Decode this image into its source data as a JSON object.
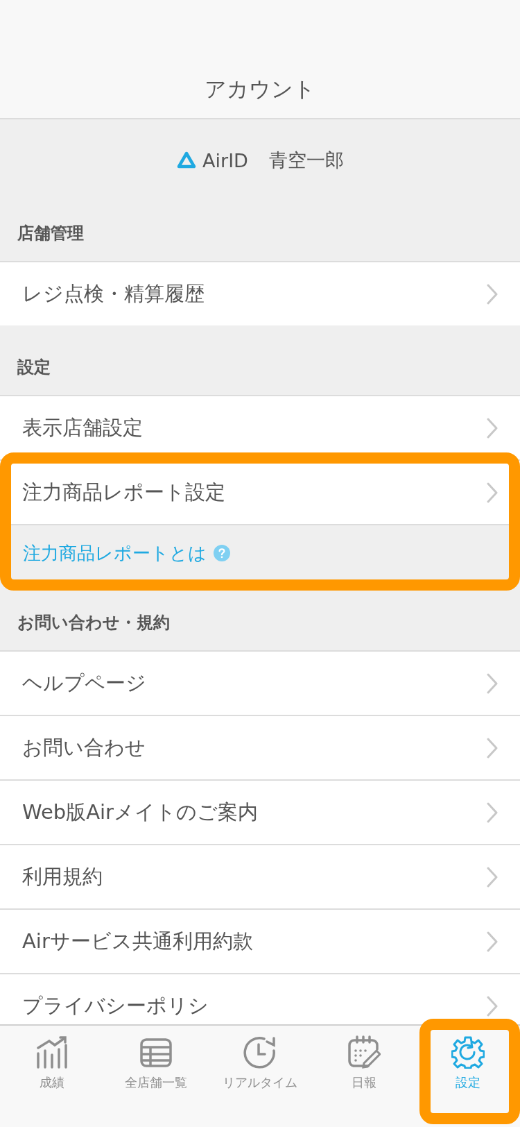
{
  "header": {
    "title": "アカウント"
  },
  "account": {
    "label": "AirID",
    "name": "青空一郎"
  },
  "sections": [
    {
      "title": "店舗管理",
      "items": [
        {
          "label": "レジ点検・精算履歴",
          "highlighted": false
        }
      ]
    },
    {
      "title": "設定",
      "items": [
        {
          "label": "表示店舗設定",
          "highlighted": false
        },
        {
          "label": "注力商品レポート設定",
          "highlighted": true,
          "help_link": "注力商品レポートとは"
        }
      ]
    },
    {
      "title": "お問い合わせ・規約",
      "items": [
        {
          "label": "ヘルプページ",
          "highlighted": false
        },
        {
          "label": "お問い合わせ",
          "highlighted": false
        },
        {
          "label": "Web版Airメイトのご案内",
          "highlighted": false
        },
        {
          "label": "利用規約",
          "highlighted": false
        },
        {
          "label": "Airサービス共通利用約款",
          "highlighted": false
        },
        {
          "label": "プライバシーポリシ",
          "highlighted": false
        }
      ]
    }
  ],
  "tab_bar": [
    {
      "label": "成績",
      "kind": "chart",
      "selected": false,
      "highlighted": false
    },
    {
      "label": "全店舗一覧",
      "kind": "table",
      "selected": false,
      "highlighted": false
    },
    {
      "label": "リアルタイム",
      "kind": "clock",
      "selected": false,
      "highlighted": false
    },
    {
      "label": "日報",
      "kind": "calendar",
      "selected": false,
      "highlighted": false
    },
    {
      "label": "設定",
      "kind": "gear",
      "selected": true,
      "highlighted": true
    }
  ]
}
